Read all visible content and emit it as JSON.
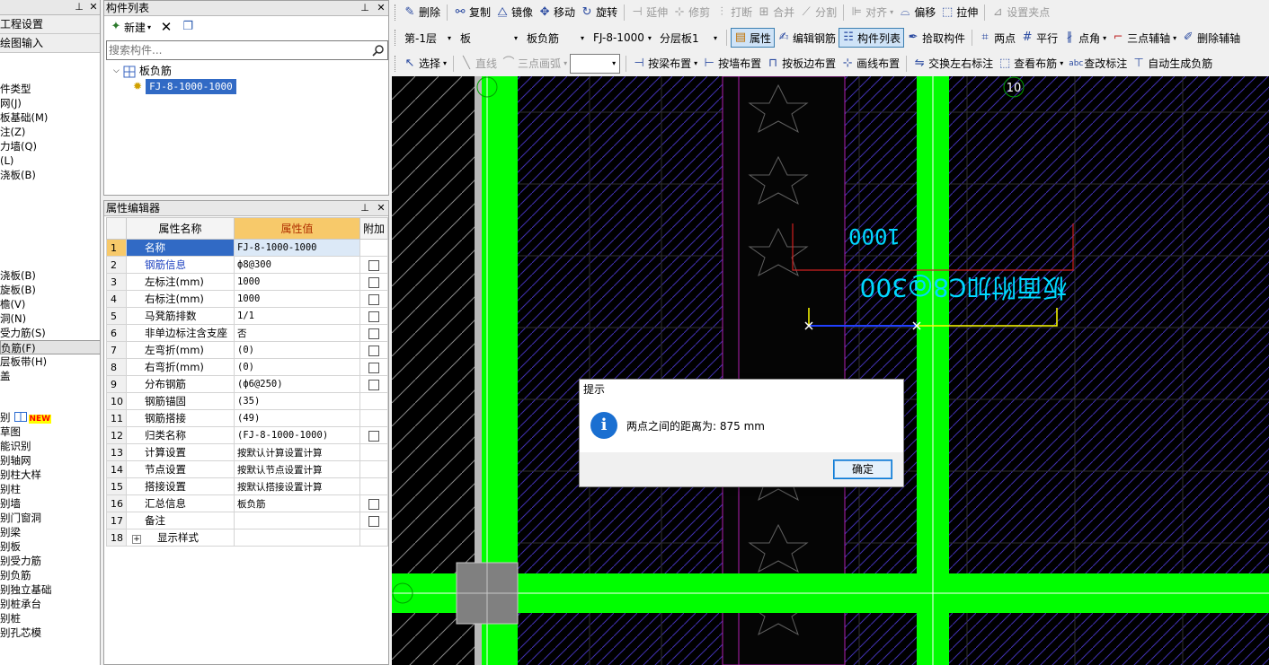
{
  "nav": {
    "title": "",
    "buttons": [
      "工程设置",
      "绘图输入"
    ],
    "items": [
      {
        "label": "件类型",
        "selected": false
      },
      {
        "label": "网(J)",
        "selected": false
      },
      {
        "label": "板基础(M)",
        "selected": false
      },
      {
        "label": "注(Z)",
        "selected": false
      },
      {
        "label": "力墙(Q)",
        "selected": false
      },
      {
        "label": "(L)",
        "selected": false
      },
      {
        "label": "浇板(B)",
        "selected": false
      },
      {
        "label": "",
        "selected": false
      },
      {
        "label": "",
        "selected": false
      },
      {
        "label": "",
        "selected": false
      },
      {
        "label": "",
        "selected": false
      },
      {
        "label": "",
        "selected": false
      },
      {
        "label": "",
        "selected": false
      },
      {
        "label": "浇板(B)",
        "selected": false
      },
      {
        "label": "旋板(B)",
        "selected": false
      },
      {
        "label": "檐(V)",
        "selected": false
      },
      {
        "label": "洞(N)",
        "selected": false
      },
      {
        "label": "受力筋(S)",
        "selected": false
      },
      {
        "label": "负筋(F)",
        "selected": true
      },
      {
        "label": "层板带(H)",
        "selected": false
      },
      {
        "label": "盖",
        "selected": false
      }
    ],
    "items2": [
      {
        "label": "别",
        "new": "NEW"
      },
      {
        "label": "草图"
      },
      {
        "label": "能识别"
      },
      {
        "label": "别轴网"
      },
      {
        "label": "别柱大样"
      },
      {
        "label": "别柱"
      },
      {
        "label": "别墙"
      },
      {
        "label": "别门窗洞"
      },
      {
        "label": "别梁"
      },
      {
        "label": "别板"
      },
      {
        "label": "别受力筋"
      },
      {
        "label": "别负筋"
      },
      {
        "label": "别独立基础"
      },
      {
        "label": "别桩承台"
      },
      {
        "label": "别桩"
      },
      {
        "label": "别孔芯模"
      }
    ]
  },
  "comp_list": {
    "title": "构件列表",
    "new_label": "新建",
    "search_placeholder": "搜索构件...",
    "tree_root": "板负筋",
    "tree_child": "FJ-8-1000-1000"
  },
  "prop_editor": {
    "title": "属性编辑器",
    "col_name": "属性名称",
    "col_value": "属性值",
    "col_extra": "附加",
    "rows": [
      {
        "num": "1",
        "name": "名称",
        "value": "FJ-8-1000-1000",
        "blue": false,
        "checkbox": false
      },
      {
        "num": "2",
        "name": "钢筋信息",
        "value": "ф8@300",
        "blue": true,
        "checkbox": true
      },
      {
        "num": "3",
        "name": "左标注(mm)",
        "value": "1000",
        "blue": false,
        "checkbox": true
      },
      {
        "num": "4",
        "name": "右标注(mm)",
        "value": "1000",
        "blue": false,
        "checkbox": true
      },
      {
        "num": "5",
        "name": "马凳筋排数",
        "value": "1/1",
        "blue": false,
        "checkbox": true
      },
      {
        "num": "6",
        "name": "非单边标注含支座",
        "value": "否",
        "blue": false,
        "checkbox": true
      },
      {
        "num": "7",
        "name": "左弯折(mm)",
        "value": "(0)",
        "blue": false,
        "checkbox": true
      },
      {
        "num": "8",
        "name": "右弯折(mm)",
        "value": "(0)",
        "blue": false,
        "checkbox": true
      },
      {
        "num": "9",
        "name": "分布钢筋",
        "value": "(ф6@250)",
        "blue": false,
        "checkbox": true
      },
      {
        "num": "10",
        "name": "钢筋锚固",
        "value": "(35)",
        "blue": false,
        "checkbox": false
      },
      {
        "num": "11",
        "name": "钢筋搭接",
        "value": "(49)",
        "blue": false,
        "checkbox": false
      },
      {
        "num": "12",
        "name": "归类名称",
        "value": "(FJ-8-1000-1000)",
        "blue": false,
        "checkbox": true
      },
      {
        "num": "13",
        "name": "计算设置",
        "value": "按默认计算设置计算",
        "blue": false,
        "checkbox": false
      },
      {
        "num": "14",
        "name": "节点设置",
        "value": "按默认节点设置计算",
        "blue": false,
        "checkbox": false
      },
      {
        "num": "15",
        "name": "搭接设置",
        "value": "按默认搭接设置计算",
        "blue": false,
        "checkbox": false
      },
      {
        "num": "16",
        "name": "汇总信息",
        "value": "板负筋",
        "blue": false,
        "checkbox": true
      },
      {
        "num": "17",
        "name": "备注",
        "value": "",
        "blue": false,
        "checkbox": true
      },
      {
        "num": "18",
        "name": "显示样式",
        "value": "",
        "blue": false,
        "checkbox": false
      }
    ]
  },
  "toolbar1": [
    "删除",
    "复制",
    "镜像",
    "移动",
    "旋转",
    "延伸",
    "修剪",
    "打断",
    "合并",
    "分割",
    "对齐",
    "偏移",
    "拉伸",
    "设置夹点"
  ],
  "toolbar2": {
    "floor": "第-1层",
    "category": "板",
    "type": "板负筋",
    "component": "FJ-8-1000",
    "layer": "分层板1",
    "buttons": [
      "属性",
      "编辑钢筋",
      "构件列表",
      "拾取构件",
      "两点",
      "平行",
      "点角",
      "三点辅轴",
      "删除辅轴"
    ]
  },
  "toolbar3": [
    "选择",
    "直线",
    "三点画弧",
    "按梁布置",
    "按墙布置",
    "按板边布置",
    "画线布置",
    "交换左右标注",
    "查看布筋",
    "查改标注",
    "自动生成负筋"
  ],
  "canvas": {
    "axis_label_top": "10",
    "dim_text": "1000",
    "rebar_text": "板面附加C8@300"
  },
  "dialog": {
    "title": "提示",
    "message": "两点之间的距离为: 875 mm",
    "ok_label": "确定"
  },
  "colors": {
    "beam_green": "#00ff00",
    "canvas_bg": "#000000",
    "hatch": "#3a2aa0",
    "annotation_cyan": "#00d8ff",
    "annotation_red": "#d02020",
    "measure_yellow": "#ffff00",
    "selection_blue": "#316ac5"
  }
}
